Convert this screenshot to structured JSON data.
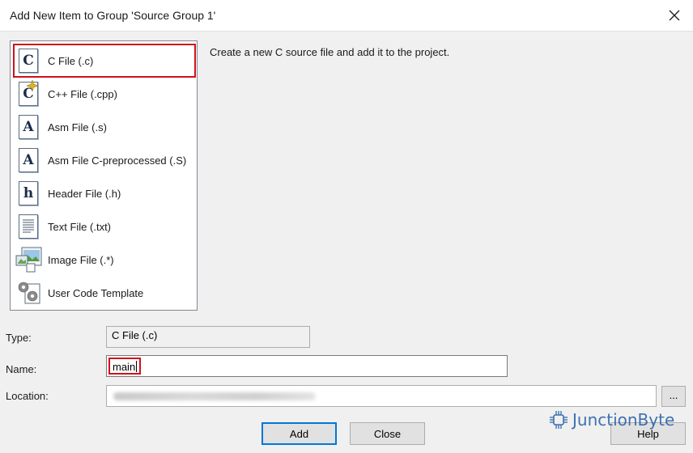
{
  "window": {
    "title": "Add New Item to Group 'Source Group 1'"
  },
  "file_types": [
    {
      "label": "C File (.c)",
      "icon": "c-file-icon",
      "glyph": "C",
      "selected": true
    },
    {
      "label": "C++ File (.cpp)",
      "icon": "cpp-file-icon",
      "glyph": "C",
      "selected": false
    },
    {
      "label": "Asm File (.s)",
      "icon": "asm-file-icon",
      "glyph": "A",
      "selected": false
    },
    {
      "label": "Asm File C-preprocessed (.S)",
      "icon": "asm-preprocessed-file-icon",
      "glyph": "A",
      "selected": false
    },
    {
      "label": "Header File (.h)",
      "icon": "header-file-icon",
      "glyph": "h",
      "selected": false
    },
    {
      "label": "Text File (.txt)",
      "icon": "text-file-icon",
      "glyph": "",
      "selected": false
    },
    {
      "label": "Image File (.*)",
      "icon": "image-file-icon",
      "glyph": "",
      "selected": false
    },
    {
      "label": "User Code Template",
      "icon": "code-template-icon",
      "glyph": "",
      "selected": false
    }
  ],
  "description": "Create a new C source file and add it to the project.",
  "form": {
    "type_label": "Type:",
    "type_value": "C File (.c)",
    "name_label": "Name:",
    "name_value": "main",
    "location_label": "Location:",
    "browse_label": "..."
  },
  "buttons": {
    "add": "Add",
    "close": "Close",
    "help": "Help"
  },
  "watermark": {
    "text": "JunctionByte"
  },
  "colors": {
    "highlight": "#d0101a",
    "watermark": "#1f5ba5"
  }
}
